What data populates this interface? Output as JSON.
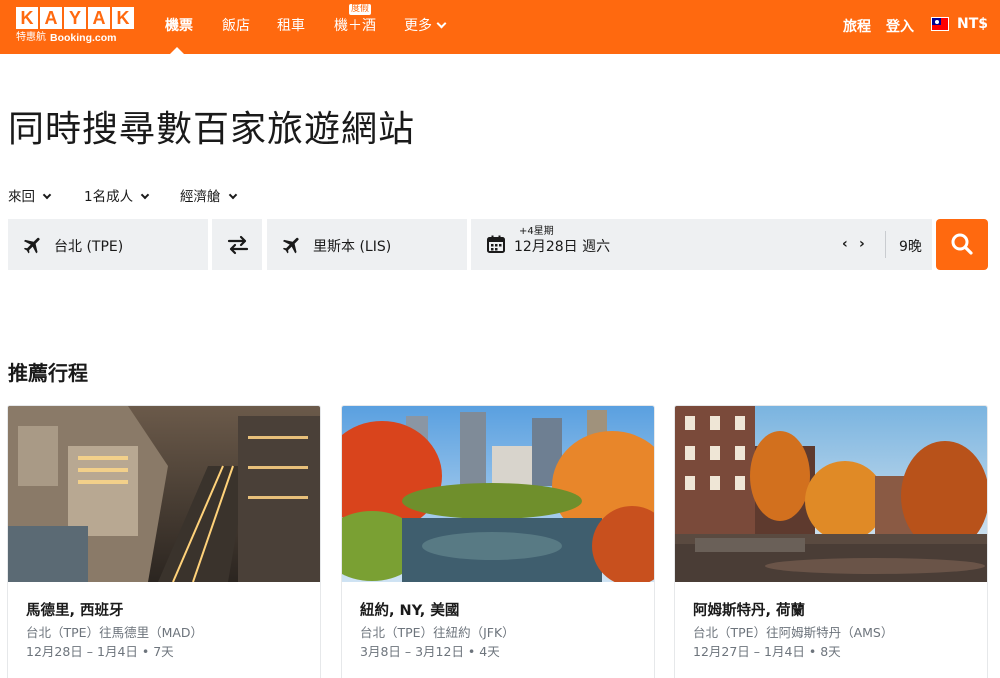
{
  "brand": {
    "letters": [
      "K",
      "A",
      "Y",
      "A",
      "K"
    ],
    "sub_chinese": "特惠航",
    "sub_partner": "Booking.com",
    "color": "#ff690f"
  },
  "nav": {
    "items": [
      {
        "label": "機票",
        "active": true
      },
      {
        "label": "飯店"
      },
      {
        "label": "租車"
      },
      {
        "label": "機＋酒",
        "badge": "度假"
      },
      {
        "label": "更多"
      }
    ]
  },
  "header_right": {
    "trips": "旅程",
    "login": "登入",
    "currency": "NT$"
  },
  "page_title": "同時搜尋數百家旅遊網站",
  "options": {
    "trip_type": "來回",
    "travelers": "1名成人",
    "cabin": "經濟艙"
  },
  "search": {
    "origin": "台北 (TPE)",
    "destination": "里斯本 (LIS)",
    "date_flex": "+4星期",
    "date": "12月28日 週六",
    "prev": "‹",
    "next": "›",
    "nights": "9晚"
  },
  "recommended": {
    "title": "推薦行程",
    "cards": [
      {
        "title": "馬德里, 西班牙",
        "route": "台北（TPE）往馬德里（MAD）",
        "dates": "12月28日 – 1月4日 • 7天"
      },
      {
        "title": "紐約, NY, 美國",
        "route": "台北（TPE）往紐約（JFK）",
        "dates": "3月8日 – 3月12日 • 4天"
      },
      {
        "title": "阿姆斯特丹, 荷蘭",
        "route": "台北（TPE）往阿姆斯特丹（AMS）",
        "dates": "12月27日 – 1月4日 • 8天"
      }
    ]
  }
}
